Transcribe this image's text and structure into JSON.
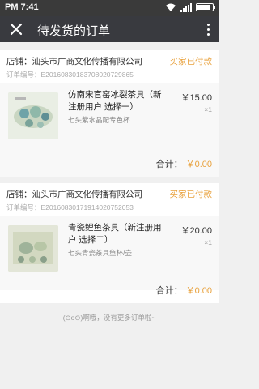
{
  "status_bar": {
    "time": "PM 7:41"
  },
  "header": {
    "title": "待发货的订单",
    "close_icon": "close-icon",
    "more_icon": "more-vertical-icon"
  },
  "orders": [
    {
      "store": "店铺：汕头市广商文化传播有限公司",
      "status": "买家已付款",
      "order_no": "订单编号：E20160830183708020729865",
      "product_name": "仿南宋官窑冰裂茶具（新注册用户 选择一）",
      "product_spec": "七头紫水晶配专色杯",
      "price": "￥15.00",
      "qty": "×1",
      "total_label": "合计：",
      "total_amount": "￥0.00"
    },
    {
      "store": "店铺：汕头市广商文化传播有限公司",
      "status": "买家已付款",
      "order_no": "订单编号：E20160830171914020752053",
      "product_name": "青瓷鲤鱼茶具（新注册用户 选择二）",
      "product_spec": "七头青瓷茶具鱼杯/壶",
      "price": "￥20.00",
      "qty": "×1",
      "total_label": "合计：",
      "total_amount": "￥0.00"
    }
  ],
  "footer": {
    "text": "(⊙o⊙)啊哦，没有更多订单啦~"
  }
}
